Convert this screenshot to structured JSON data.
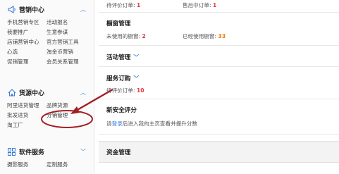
{
  "sidebar": {
    "marketing": {
      "title": "营销中心",
      "links": [
        "手机营销专区",
        "活动报名",
        "我要推广",
        "生意参谋",
        "店铺营销中心",
        "官方营销工具",
        "心选",
        "淘金币营销",
        "促销管理",
        "会员关系管理"
      ]
    },
    "sourcing": {
      "title": "货源中心",
      "links": [
        "阿里进货管理",
        "品牌货源",
        "批发进货",
        "分销管理",
        "淘工厂"
      ]
    },
    "software": {
      "title": "软件服务",
      "links": [
        "摄影服务",
        "定制服务"
      ]
    }
  },
  "main": {
    "top_row": {
      "pending_review_label": "待评价订单:",
      "pending_review_count": "1",
      "aftersale_label": "售后中订单:",
      "aftersale_count": "1"
    },
    "showcase": {
      "title": "橱窗管理",
      "unused_label": "未使用的橱窗:",
      "unused_count": "2",
      "used_label": "已经使用橱窗:",
      "used_count": "33"
    },
    "activity": {
      "title": "活动管理"
    },
    "service_order": {
      "title": "服务订购",
      "pending_label": "待评价订单:",
      "pending_count": "10"
    },
    "security": {
      "title": "新安全评分",
      "text_before": "请",
      "login_link": "登录",
      "text_after": "后进入我的主页查看并提升分数"
    },
    "assets": {
      "title": "资金管理"
    }
  },
  "colors": {
    "accent": "#3b7ad6",
    "count_red": "#e4393c",
    "count_orange": "#f17a00",
    "annotation": "#a31d24"
  },
  "icons": {
    "marketing": "megaphone-icon",
    "sourcing": "home-icon",
    "software": "grid-icon"
  }
}
